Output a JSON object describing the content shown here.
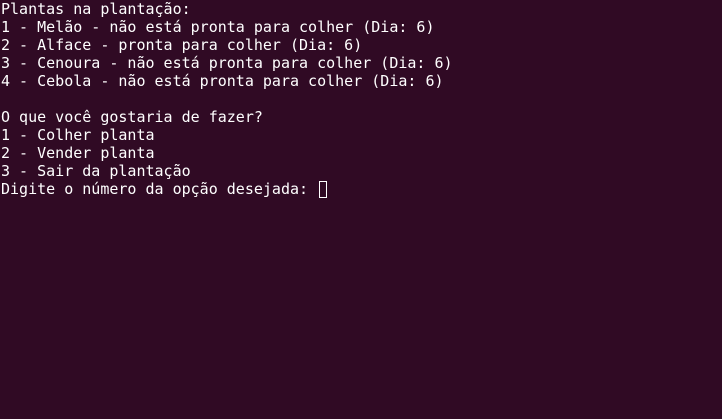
{
  "terminal": {
    "plants_header": "Plantas na plantação:",
    "plants": [
      "1 - Melão - não está pronta para colher (Dia: 6)",
      "2 - Alface - pronta para colher (Dia: 6)",
      "3 - Cenoura - não está pronta para colher (Dia: 6)",
      "4 - Cebola - não está pronta para colher (Dia: 6)"
    ],
    "menu_question": "O que você gostaria de fazer?",
    "menu_options": [
      "1 - Colher planta",
      "2 - Vender planta",
      "3 - Sair da plantação"
    ],
    "input_prompt": "Digite o número da opção desejada: ",
    "input_value": ""
  }
}
